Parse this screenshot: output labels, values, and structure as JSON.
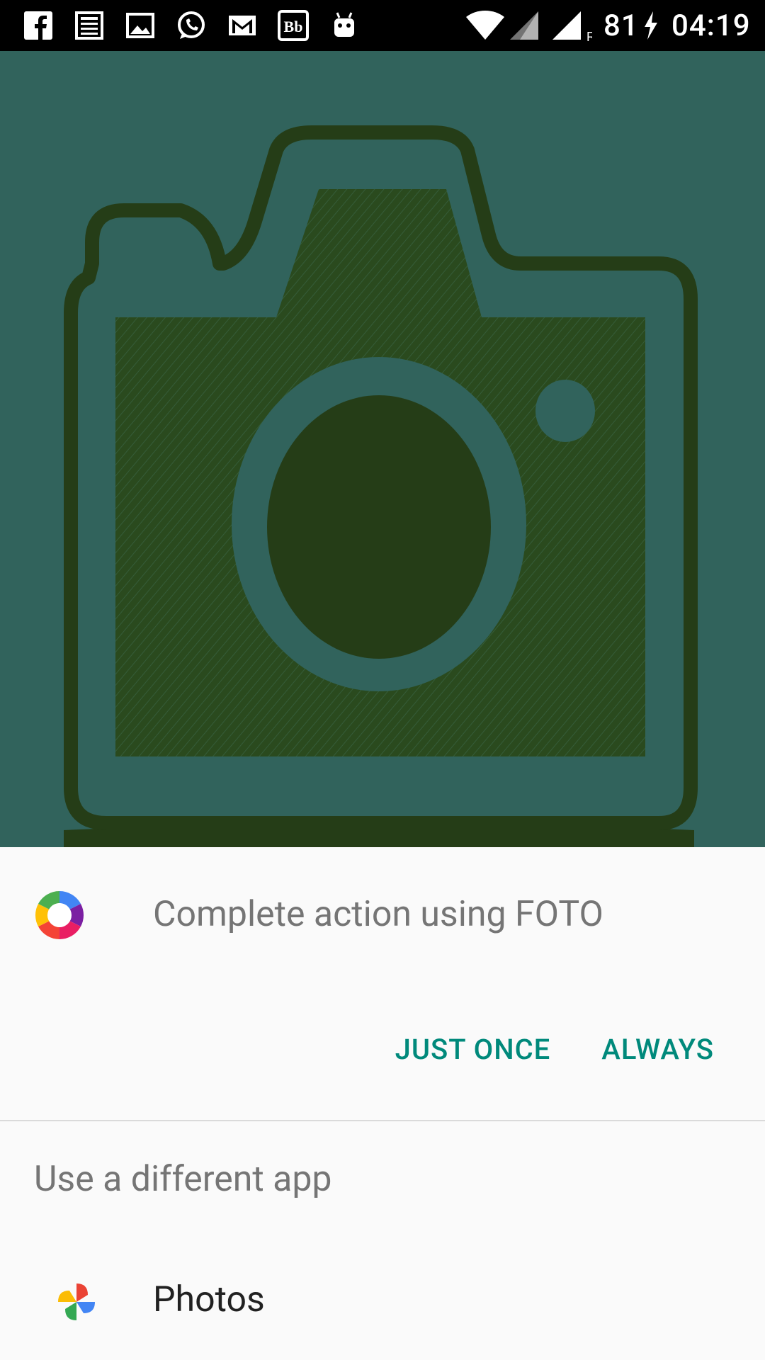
{
  "status_bar": {
    "notification_icons": [
      "facebook-icon",
      "news-icon",
      "image-icon",
      "whatsapp-icon",
      "gmail-icon",
      "bb-icon",
      "android-icon"
    ],
    "battery": "81",
    "time": "04:19"
  },
  "dialog": {
    "title": "Complete action using FOTO",
    "just_once_label": "JUST ONCE",
    "always_label": "ALWAYS",
    "subheader": "Use a different app",
    "apps": [
      {
        "label": "Photos",
        "icon": "google-photos-icon"
      }
    ]
  },
  "colors": {
    "accent": "#00897B",
    "hero_background": "#31635C",
    "camera_dark": "#253D17"
  }
}
